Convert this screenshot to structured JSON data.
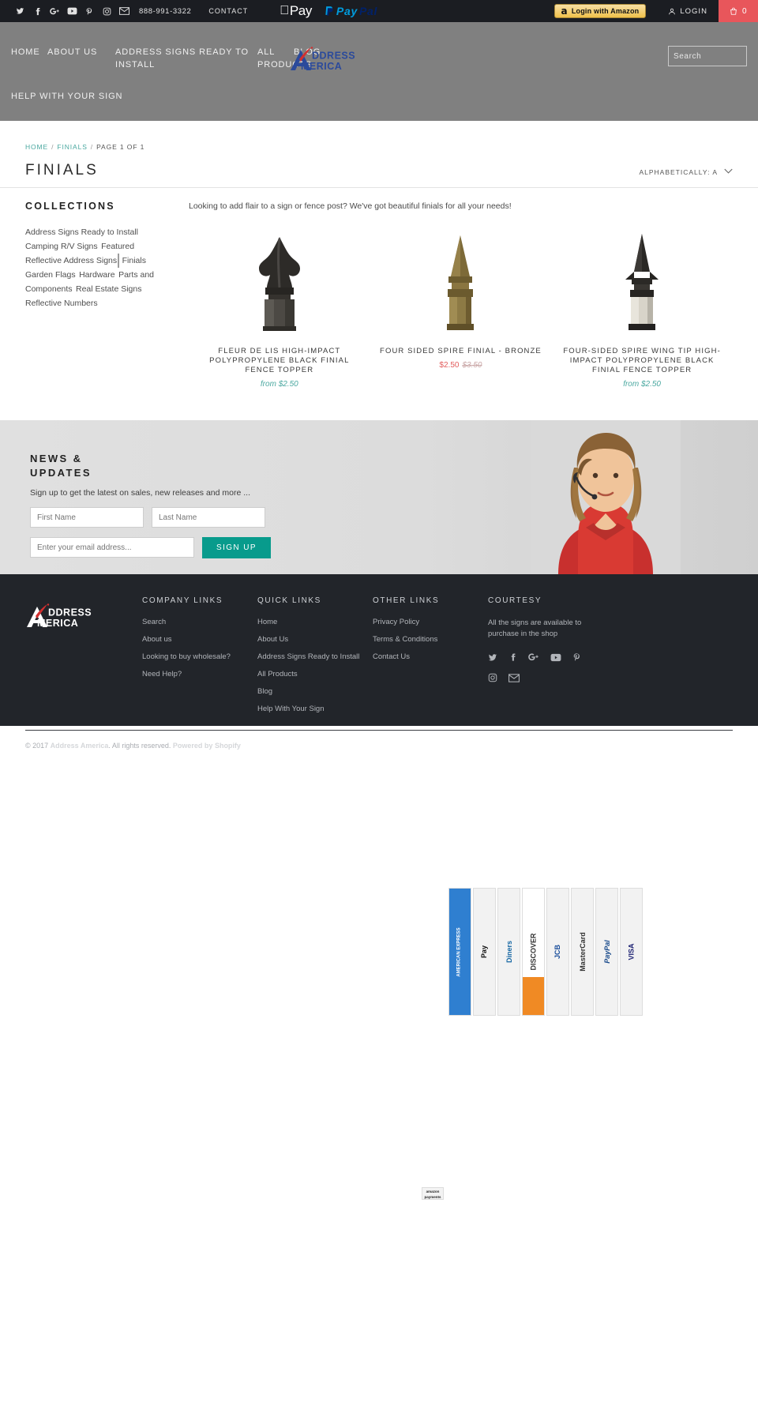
{
  "topbar": {
    "social_icons": [
      "twitter-icon",
      "facebook-icon",
      "google-plus-icon",
      "youtube-icon",
      "pinterest-icon",
      "instagram-icon",
      "email-icon"
    ],
    "phone": "888-991-3322",
    "contact_label": "CONTACT",
    "apple_pay_label": "Pay",
    "paypal_label_1": "Pay",
    "paypal_label_2": "Pal",
    "amazon_login_label": "Login with Amazon",
    "amazon_mark": "a",
    "login_label": "LOGIN",
    "cart_count": "0"
  },
  "header": {
    "nav": [
      {
        "label": "HOME"
      },
      {
        "label": "ABOUT US"
      },
      {
        "label": "ADDRESS SIGNS READY TO INSTALL"
      },
      {
        "label": "ALL PRODUCTS"
      },
      {
        "label": "BLOG"
      },
      {
        "label": "HELP WITH YOUR SIGN"
      }
    ],
    "logo_line1": "DDRESS",
    "logo_line2": "MERICA",
    "search_placeholder": "Search",
    "search_value": ""
  },
  "breadcrumb": {
    "home": "HOME",
    "collection": "FINIALS",
    "page": "PAGE 1 OF 1"
  },
  "page": {
    "title": "FINIALS",
    "sort_label": "ALPHABETICALLY: A",
    "blurb": "Looking to add flair to a sign or fence post? We've got beautiful finials for all your needs!"
  },
  "sidebar": {
    "heading": "COLLECTIONS",
    "items": [
      {
        "label": "Address Signs Ready to Install",
        "active": false
      },
      {
        "label": "Camping R/V Signs",
        "active": false
      },
      {
        "label": "Featured Reflective Address Signs",
        "active": false
      },
      {
        "label": "Finials",
        "active": true
      },
      {
        "label": "Garden Flags",
        "active": false
      },
      {
        "label": "Hardware",
        "active": false
      },
      {
        "label": "Parts and Components",
        "active": false
      },
      {
        "label": "Real Estate Signs",
        "active": false
      },
      {
        "label": "Reflective Numbers",
        "active": false
      }
    ]
  },
  "products": [
    {
      "name": "FLEUR DE LIS HIGH-IMPACT POLYPROPYLENE BLACK FINIAL FENCE TOPPER",
      "price_prefix": "from",
      "price": "$2.50",
      "sale_price": "",
      "compare_price": ""
    },
    {
      "name": "FOUR SIDED SPIRE FINIAL - BRONZE",
      "price_prefix": "",
      "price": "",
      "sale_price": "$2.50",
      "compare_price": "$3.50"
    },
    {
      "name": "FOUR-SIDED SPIRE WING TIP HIGH-IMPACT POLYPROPYLENE BLACK FINIAL FENCE TOPPER",
      "price_prefix": "from",
      "price": "$2.50",
      "sale_price": "",
      "compare_price": ""
    }
  ],
  "newsletter": {
    "heading": "NEWS & UPDATES",
    "subtext": "Sign up to get the latest on sales, new releases and more ...",
    "first_name_placeholder": "First Name",
    "last_name_placeholder": "Last Name",
    "email_placeholder": "Enter your email address...",
    "signup_label": "SIGN UP"
  },
  "footer": {
    "logo_line1": "DDRESS",
    "logo_line2": "MERICA",
    "columns": [
      {
        "heading": "COMPANY LINKS",
        "links": [
          "Search",
          "About us",
          "Looking to buy wholesale?",
          "Need Help?"
        ]
      },
      {
        "heading": "QUICK LINKS",
        "links": [
          "Home",
          "About Us",
          "Address Signs Ready to Install",
          "All Products",
          "Blog",
          "Help With Your Sign"
        ]
      },
      {
        "heading": "OTHER LINKS",
        "links": [
          "Privacy Policy",
          "Terms & Conditions",
          "Contact Us"
        ]
      }
    ],
    "courtesy": {
      "heading": "COURTESY",
      "note": "All the signs are available to purchase in the shop",
      "social_row_1": [
        "twitter-icon",
        "facebook-icon",
        "google-plus-icon",
        "youtube-icon",
        "pinterest-icon"
      ],
      "social_row_2": [
        "instagram-icon",
        "email-icon"
      ]
    },
    "copyright_prefix": "© 2017",
    "copyright_brand": "Address America",
    "copyright_mid": ". All rights reserved.",
    "powered_by": "Powered by Shopify"
  },
  "payments": [
    {
      "name": "american-express",
      "label": "AMERICAN EXPRESS",
      "cls": "amex"
    },
    {
      "name": "apple-pay",
      "label": "Pay",
      "cls": "apple"
    },
    {
      "name": "diners-club",
      "label": "Diners",
      "cls": "diners"
    },
    {
      "name": "discover",
      "label": "DISCOVER",
      "cls": "discover"
    },
    {
      "name": "jcb",
      "label": "JCB",
      "cls": "jcb"
    },
    {
      "name": "mastercard",
      "label": "MasterCard",
      "cls": "mastercard"
    },
    {
      "name": "paypal",
      "label": "PayPal",
      "cls": "paypal"
    },
    {
      "name": "visa",
      "label": "VISA",
      "cls": "visa"
    }
  ],
  "amazon_badge": {
    "line1": "amazon",
    "line2": "payments"
  },
  "colors": {
    "accent_teal": "#089b8c",
    "link_teal": "#4aa8a0",
    "cart_red": "#e8565b",
    "header_gray": "#808080",
    "footer_dark": "#22252a",
    "amazon_yellow": "#f0c14b",
    "sale_red": "#e25c5c"
  }
}
